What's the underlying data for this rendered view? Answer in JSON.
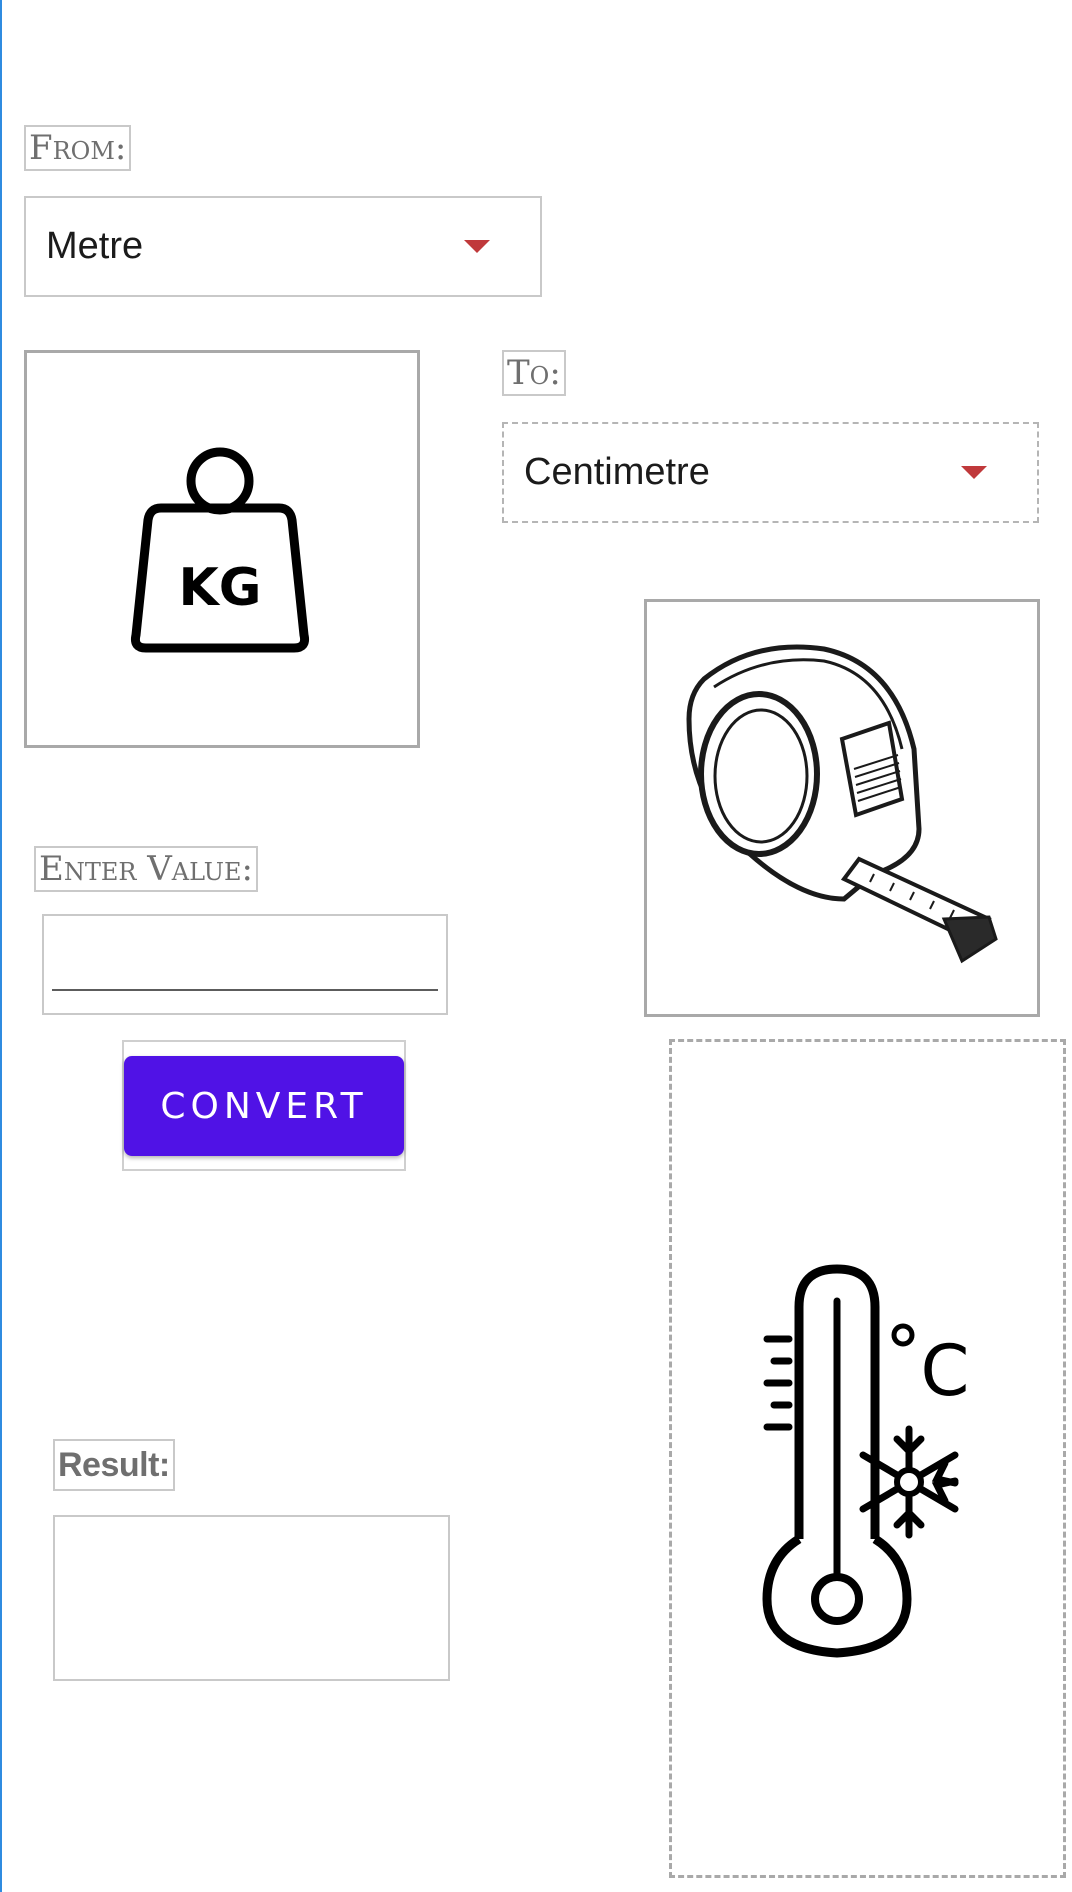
{
  "form": {
    "from_label": "From:",
    "from_value": "Metre",
    "to_label": "To:",
    "to_value": "Centimetre",
    "enter_label": "Enter Value:",
    "value_input": "",
    "convert_label": "CONVERT",
    "result_label": "Result:",
    "result_value": ""
  },
  "icons": {
    "weight": "kg-weight-icon",
    "tape": "tape-measure-icon",
    "thermo": "thermometer-celsius-icon",
    "kg_text": "KG",
    "celsius_text": "C"
  },
  "colors": {
    "accent": "#5012e6",
    "caret": "#c0393b"
  }
}
